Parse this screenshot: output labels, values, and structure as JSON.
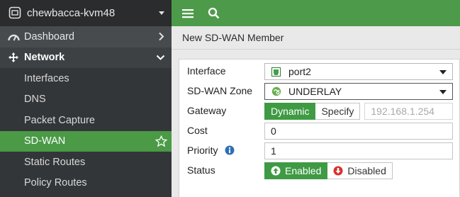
{
  "sidebar": {
    "hostname": "chewbacca-kvm48",
    "top_item": {
      "label": "Dashboard",
      "icon": "dashboard-icon"
    },
    "section": {
      "label": "Network",
      "icon": "network-move-icon"
    },
    "items": [
      {
        "label": "Interfaces"
      },
      {
        "label": "DNS"
      },
      {
        "label": "Packet Capture"
      },
      {
        "label": "SD-WAN",
        "active": true
      },
      {
        "label": "Static Routes"
      },
      {
        "label": "Policy Routes"
      }
    ]
  },
  "topbar": {
    "menu_icon": "hamburger-icon",
    "search_icon": "search-icon",
    "color": "#4d9b4a"
  },
  "page": {
    "title": "New SD-WAN Member"
  },
  "form": {
    "interface": {
      "label": "Interface",
      "value": "port2"
    },
    "zone": {
      "label": "SD-WAN Zone",
      "value": "UNDERLAY"
    },
    "gateway": {
      "label": "Gateway",
      "opt_dynamic": "Dynamic",
      "opt_specify": "Specify",
      "placeholder": "192.168.1.254"
    },
    "cost": {
      "label": "Cost",
      "value": "0"
    },
    "priority": {
      "label": "Priority",
      "value": "1"
    },
    "status": {
      "label": "Status",
      "enabled": "Enabled",
      "disabled": "Disabled"
    }
  },
  "colors": {
    "accent": "#4a9a46",
    "disabled_red": "#d9312b",
    "info_blue": "#2f6fb5"
  }
}
